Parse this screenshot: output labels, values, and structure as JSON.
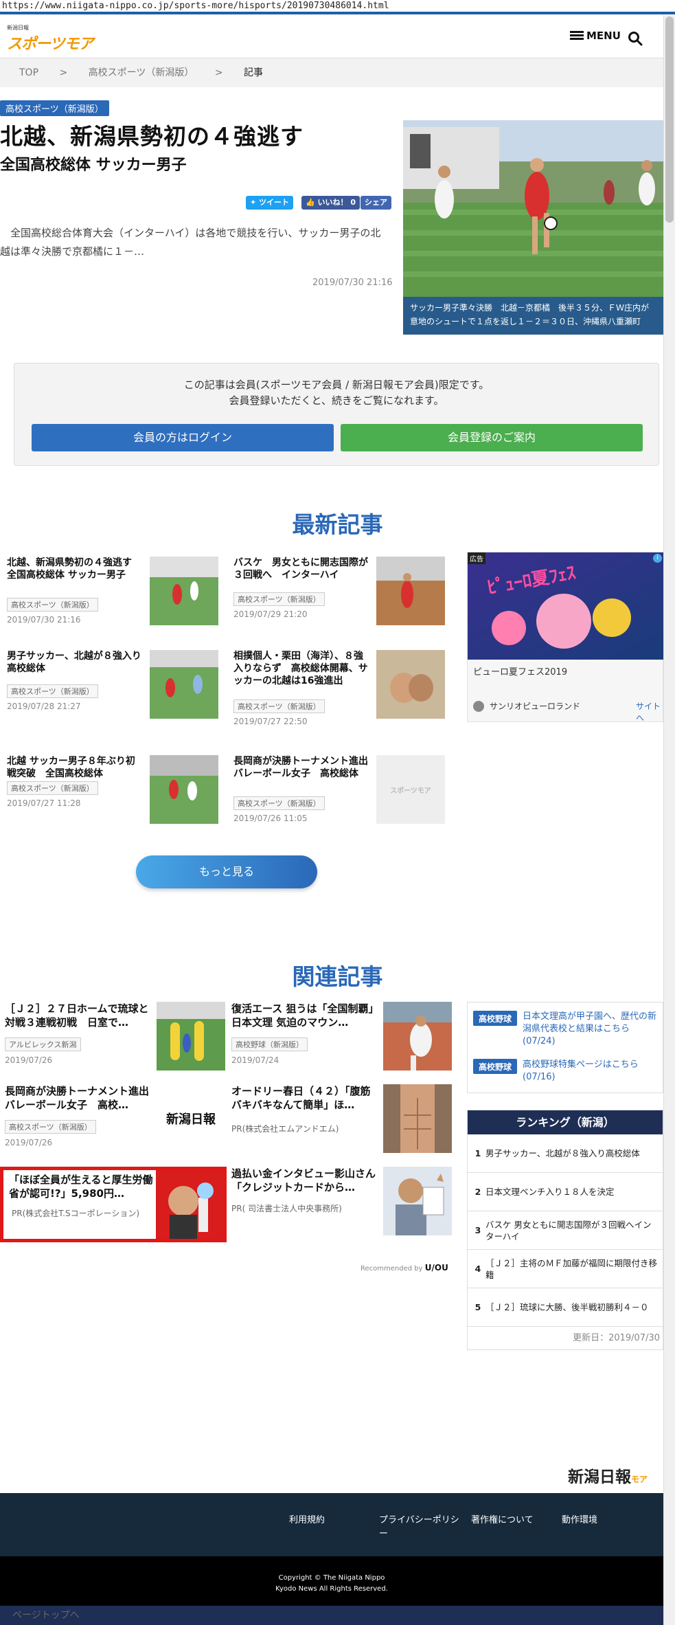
{
  "browser": {
    "url": "https://www.niigata-nippo.co.jp/sports-more/hisports/20190730486014.html"
  },
  "header": {
    "logo_small": "新潟日報",
    "logo_big": "スポーツモア",
    "menu_label": "MENU"
  },
  "breadcrumb": [
    "TOP",
    ">",
    "高校スポーツ（新潟版）",
    ">",
    "記事"
  ],
  "article": {
    "category": "高校スポーツ（新潟版）",
    "title": "北越、新潟県勢初の４強逃す",
    "subtitle": "全国高校総体 サッカー男子",
    "share_tweet": "ツイート",
    "share_like": "いいね！ 0",
    "share_share": "シェア",
    "lead": "全国高校総合体育大会（インターハイ）は各地で競技を行い、サッカー男子の北越は準々決勝で京都橘に１－…",
    "date": "2019/07/30 21:16",
    "caption": "サッカー男子準々決勝　北越－京都橘　後半３５分、ＦＷ庄内が意地のシュートで１点を返し１－２＝３０日、沖縄県八重瀬町"
  },
  "member": {
    "line1": "この記事は会員(スポーツモア会員 / 新潟日報モア会員)限定です。",
    "line2": "会員登録いただくと、続きをご覧になれます。",
    "login_label": "会員の方はログイン",
    "register_label": "会員登録のご案内"
  },
  "latest": {
    "title": "最新記事",
    "more_label": "もっと見る",
    "items": [
      {
        "title": "北越、新潟県勢初の４強逃す　全国高校総体 サッカー男子",
        "cat": "高校スポーツ（新潟版）",
        "date": "2019/07/30 21:16"
      },
      {
        "title": "バスケ　男女ともに開志国際が３回戦へ　インターハイ",
        "cat": "高校スポーツ（新潟版）",
        "date": "2019/07/29 21:20"
      },
      {
        "title": "男子サッカー、北越が８強入り　高校総体",
        "cat": "高校スポーツ（新潟版）",
        "date": "2019/07/28 21:27"
      },
      {
        "title": "相撲個人・栗田（海洋）、８強入りならず　高校総体開幕、サッカーの北越は16強進出",
        "cat": "高校スポーツ（新潟版）",
        "date": "2019/07/27 22:50"
      },
      {
        "title": "北越 サッカー男子８年ぶり初戦突破　全国高校総体",
        "cat": "高校スポーツ（新潟版）",
        "date": "2019/07/27 11:28"
      },
      {
        "title": "長岡商が決勝トーナメント進出　バレーボール女子　高校総体",
        "cat": "高校スポーツ（新潟版）",
        "date": "2019/07/26 11:05"
      }
    ]
  },
  "ad": {
    "label": "広告",
    "title": "ピューロ夏フェス2019",
    "advertiser": "サンリオピューロランド",
    "link": "サイトへ"
  },
  "related": {
    "title": "関連記事",
    "items": [
      {
        "title": "［Ｊ２］２７日ホームで琉球と対戦３連戦初戦　日室で…",
        "cat": "アルビレックス新潟",
        "date": "2019/07/26"
      },
      {
        "title": "復活エース 狙うは「全国制覇」日本文理 気迫のマウン…",
        "cat": "高校野球（新潟版）",
        "date": "2019/07/24"
      },
      {
        "title": "長岡商が決勝トーナメント進出バレーボール女子　高校…",
        "cat": "高校スポーツ（新潟版）",
        "date": "2019/07/26"
      },
      {
        "title": "オードリー春日（４２）「腹筋バキバキなんて簡単」ほ…",
        "sub": "PR(株式会社エムアンドエム)"
      },
      {
        "title": "「ほぼ全員が生えると厚生労働省が認可!?」5,980円…",
        "sub": "PR(株式会社T.Sコーポレーション)"
      },
      {
        "title": "過払い金インタビュー影山さん「クレジットカードから…",
        "sub": "PR( 司法書士法人中央事務所)"
      }
    ],
    "recommended": "Recommended by",
    "recommended_brand": "U/OU"
  },
  "side_links": [
    {
      "badge": "高校野球",
      "text": "日本文理高が甲子園へ、歴代の新潟県代表校と結果はこちら(07/24)"
    },
    {
      "badge": "高校野球",
      "text": "高校野球特集ページはこちら(07/16)"
    }
  ],
  "ranking": {
    "title": "ランキング（新潟）",
    "items": [
      {
        "num": "1",
        "text": "男子サッカー、北越が８強入り高校総体"
      },
      {
        "num": "2",
        "text": "日本文理ベンチ入り１８人を決定"
      },
      {
        "num": "3",
        "text": "バスケ 男女ともに開志国際が３回戦へインターハイ"
      },
      {
        "num": "4",
        "text": "［Ｊ２］主将のＭＦ加藤が福岡に期限付き移籍"
      },
      {
        "num": "5",
        "text": "［Ｊ２］琉球に大勝、後半戦初勝利４－０"
      }
    ],
    "updated": "更新日：2019/07/30"
  },
  "footer": {
    "logo": "新潟日報",
    "logo_sub": "モア",
    "links": [
      "利用規約",
      "プライバシーポリシー",
      "著作権について",
      "動作環境"
    ],
    "copyright1": "Copyright © The Niigata Nippo",
    "copyright2": "Kyodo News All Rights Reserved.",
    "totop": "ページトップへ"
  }
}
